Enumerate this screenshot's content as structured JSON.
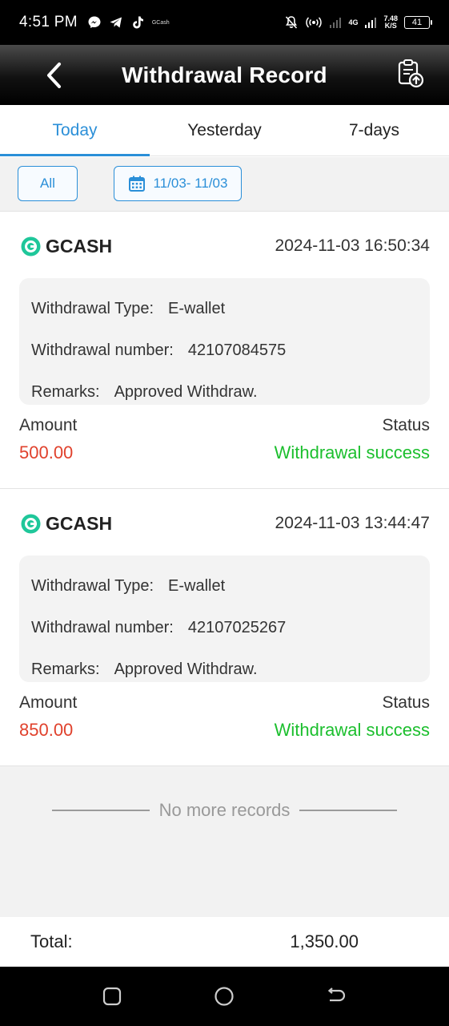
{
  "status_bar": {
    "time": "4:51 PM",
    "app_label": "GCash",
    "network_type": "4G",
    "speed_value": "7.48",
    "speed_unit": "K/S",
    "battery": "41"
  },
  "header": {
    "title": "Withdrawal Record"
  },
  "tabs": [
    {
      "label": "Today",
      "active": true
    },
    {
      "label": "Yesterday",
      "active": false
    },
    {
      "label": "7-days",
      "active": false
    }
  ],
  "filter": {
    "all_label": "All",
    "date_range": "11/03- 11/03"
  },
  "labels": {
    "type": "Withdrawal Type:",
    "number": "Withdrawal number:",
    "remarks": "Remarks:",
    "amount": "Amount",
    "status": "Status"
  },
  "records": [
    {
      "provider": "GCASH",
      "datetime": "2024-11-03 16:50:34",
      "type": "E-wallet",
      "number": "42107084575",
      "remarks": "Approved Withdraw.",
      "amount": "500.00",
      "status": "Withdrawal success"
    },
    {
      "provider": "GCASH",
      "datetime": "2024-11-03 13:44:47",
      "type": "E-wallet",
      "number": "42107025267",
      "remarks": "Approved Withdraw.",
      "amount": "850.00",
      "status": "Withdrawal success"
    }
  ],
  "no_more": "No more records",
  "total": {
    "label": "Total:",
    "value": "1,350.00"
  },
  "colors": {
    "accent": "#2b8fd8",
    "amount": "#e0412c",
    "success": "#1cbf2e",
    "gcash": "#1fc79a"
  }
}
